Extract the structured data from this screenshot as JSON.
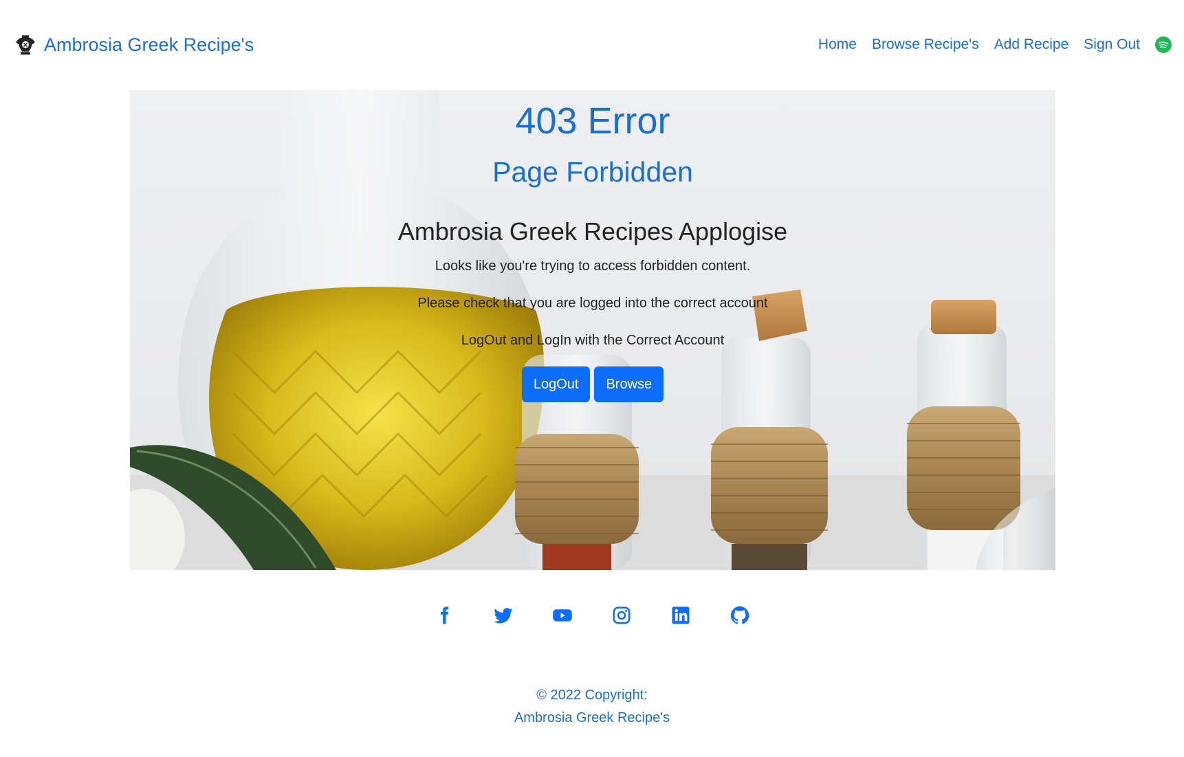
{
  "header": {
    "brand_name": "Ambrosia Greek Recipe's",
    "brand_icon": "greek-amphora-icon",
    "nav": [
      {
        "label": "Home"
      },
      {
        "label": "Browse Recipe's"
      },
      {
        "label": "Add Recipe"
      },
      {
        "label": "Sign Out"
      }
    ],
    "nav_icon": "spotify-icon"
  },
  "error": {
    "code_title": "403 Error",
    "subtitle": "Page Forbidden",
    "apology": "Ambrosia Greek Recipes Applogise",
    "message1": "Looks like you're trying to access forbidden content.",
    "message2": "Please check that you are logged into the correct account",
    "message3": "LogOut and LogIn with the Correct Account",
    "buttons": {
      "logout": "LogOut",
      "browse": "Browse"
    }
  },
  "social": [
    {
      "icon": "facebook-icon"
    },
    {
      "icon": "twitter-icon"
    },
    {
      "icon": "youtube-icon"
    },
    {
      "icon": "instagram-icon"
    },
    {
      "icon": "linkedin-icon"
    },
    {
      "icon": "github-icon"
    }
  ],
  "footer": {
    "copyright": "© 2022 Copyright:",
    "site_name": "Ambrosia Greek Recipe's"
  },
  "colors": {
    "primary": "#1a6fd0",
    "button": "#0d6efd",
    "spotify": "#1db954"
  }
}
